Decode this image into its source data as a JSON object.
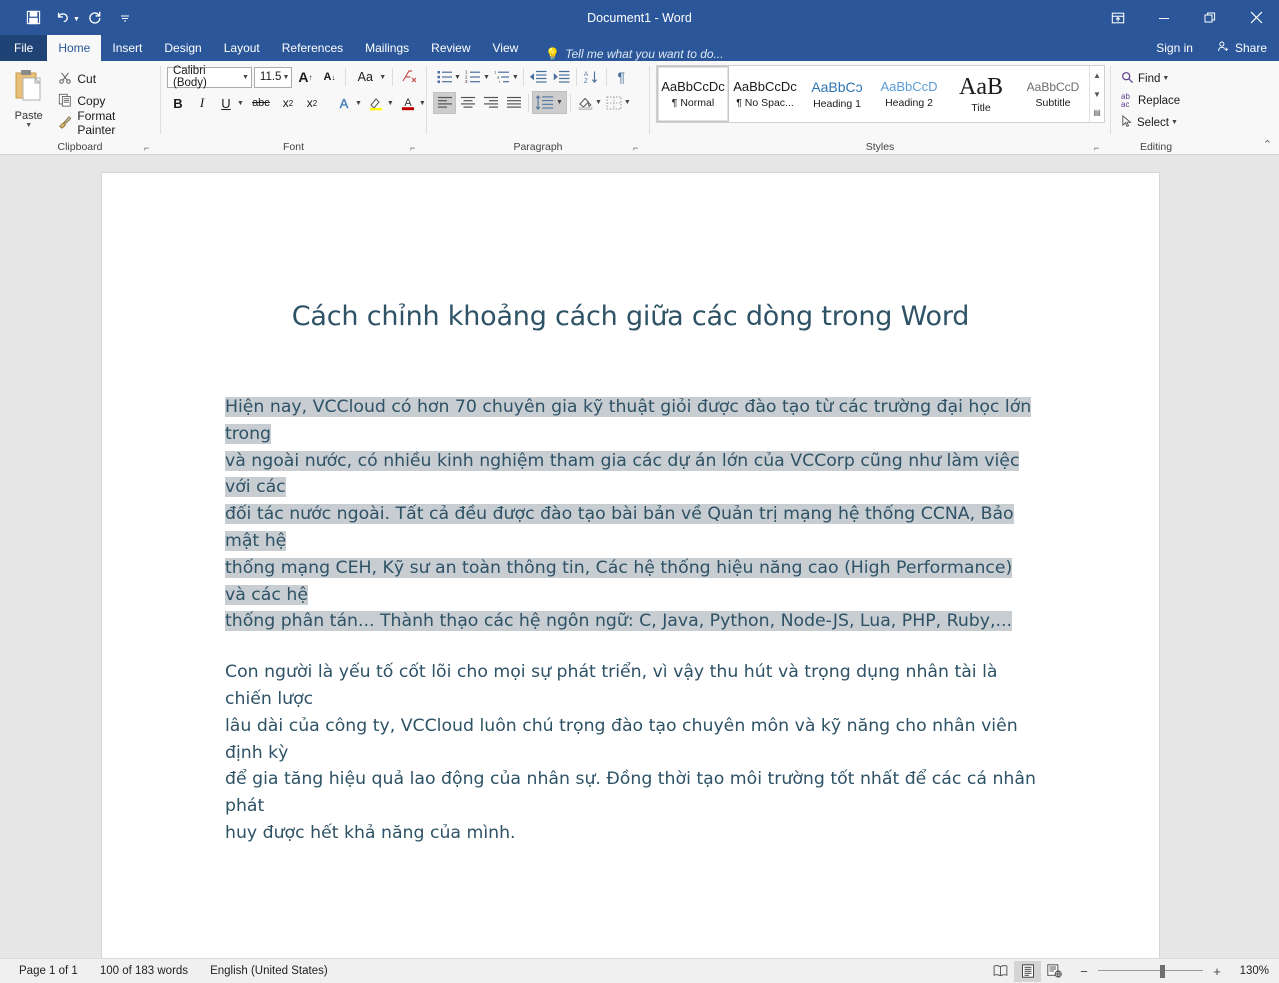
{
  "titlebar": {
    "document_title": "Document1 - Word",
    "quick_access": [
      {
        "name": "save-icon",
        "label": "Save"
      },
      {
        "name": "undo-icon",
        "label": "Undo"
      },
      {
        "name": "redo-icon",
        "label": "Redo"
      },
      {
        "name": "customize-qat-icon",
        "label": "Customize Quick Access Toolbar"
      }
    ],
    "window_controls": [
      {
        "name": "ribbon-display-options-icon",
        "label": "Ribbon Display Options"
      },
      {
        "name": "minimize-icon",
        "label": "Minimize"
      },
      {
        "name": "restore-icon",
        "label": "Restore Down"
      },
      {
        "name": "close-icon",
        "label": "Close"
      }
    ]
  },
  "tabs": {
    "items": [
      {
        "label": "File",
        "active": false
      },
      {
        "label": "Home",
        "active": true
      },
      {
        "label": "Insert",
        "active": false
      },
      {
        "label": "Design",
        "active": false
      },
      {
        "label": "Layout",
        "active": false
      },
      {
        "label": "References",
        "active": false
      },
      {
        "label": "Mailings",
        "active": false
      },
      {
        "label": "Review",
        "active": false
      },
      {
        "label": "View",
        "active": false
      }
    ],
    "tell_me": "Tell me what you want to do...",
    "sign_in": "Sign in",
    "share": "Share"
  },
  "ribbon": {
    "clipboard": {
      "label": "Clipboard",
      "paste": "Paste",
      "cut": "Cut",
      "copy": "Copy",
      "format_painter": "Format Painter"
    },
    "font": {
      "label": "Font",
      "font_name": "Calibri (Body)",
      "font_size": "11.5",
      "buttons": [
        {
          "name": "grow-font-icon",
          "label": "A"
        },
        {
          "name": "shrink-font-icon",
          "label": "A"
        },
        {
          "name": "change-case-icon",
          "label": "Aa"
        },
        {
          "name": "clear-formatting-icon",
          "label": "Clear All Formatting"
        },
        {
          "name": "bold-icon",
          "label": "B"
        },
        {
          "name": "italic-icon",
          "label": "I"
        },
        {
          "name": "underline-icon",
          "label": "U"
        },
        {
          "name": "strikethrough-icon",
          "label": "abc"
        },
        {
          "name": "subscript-icon",
          "label": "x₂"
        },
        {
          "name": "superscript-icon",
          "label": "x²"
        },
        {
          "name": "text-effects-icon",
          "label": "A"
        },
        {
          "name": "text-highlight-color-icon",
          "label": "ab"
        },
        {
          "name": "font-color-icon",
          "label": "A"
        }
      ]
    },
    "paragraph": {
      "label": "Paragraph",
      "buttons": [
        {
          "name": "bullets-icon",
          "label": "Bullets"
        },
        {
          "name": "numbering-icon",
          "label": "Numbering"
        },
        {
          "name": "multilevel-list-icon",
          "label": "Multilevel List"
        },
        {
          "name": "decrease-indent-icon",
          "label": "Decrease Indent"
        },
        {
          "name": "increase-indent-icon",
          "label": "Increase Indent"
        },
        {
          "name": "sort-icon",
          "label": "Sort"
        },
        {
          "name": "show-formatting-marks-icon",
          "label": "Show/Hide ¶"
        },
        {
          "name": "align-left-icon",
          "label": "Align Left"
        },
        {
          "name": "align-center-icon",
          "label": "Center"
        },
        {
          "name": "align-right-icon",
          "label": "Align Right"
        },
        {
          "name": "justify-icon",
          "label": "Justify"
        },
        {
          "name": "line-and-paragraph-spacing-icon",
          "label": "Line and Paragraph Spacing"
        },
        {
          "name": "shading-icon",
          "label": "Shading"
        },
        {
          "name": "borders-icon",
          "label": "Borders"
        }
      ],
      "highlighted_button": "line-and-paragraph-spacing-icon",
      "highlight_color": "#e81123"
    },
    "styles": {
      "label": "Styles",
      "items": [
        {
          "preview": "AaBbCcDc",
          "name": "¶ Normal",
          "selected": true,
          "kind": "normal"
        },
        {
          "preview": "AaBbCcDc",
          "name": "¶ No Spac...",
          "selected": false,
          "kind": "normal"
        },
        {
          "preview": "AaBbCɔ",
          "name": "Heading 1",
          "selected": false,
          "kind": "h1"
        },
        {
          "preview": "AaBbCcD",
          "name": "Heading 2",
          "selected": false,
          "kind": "h2"
        },
        {
          "preview": "AaB",
          "name": "Title",
          "selected": false,
          "kind": "title"
        },
        {
          "preview": "AaBbCcD",
          "name": "Subtitle",
          "selected": false,
          "kind": "sub"
        }
      ]
    },
    "editing": {
      "label": "Editing",
      "find": "Find",
      "replace": "Replace",
      "select": "Select"
    }
  },
  "document": {
    "title": "Cách chỉnh khoảng cách giữa các dòng trong Word",
    "paragraphs": [
      {
        "selected": true,
        "lines": [
          "Hiện nay, VCCloud có hơn 70 chuyên gia kỹ thuật giỏi được đào tạo từ các trường đại học lớn trong",
          "và ngoài nước, có nhiều kinh nghiệm tham gia các dự án lớn của VCCorp cũng như làm việc với các",
          "đối tác nước ngoài. Tất cả đều được đào tạo bài bản về Quản trị mạng hệ thống CCNA, Bảo mật hệ",
          "thống mạng CEH, Kỹ sư an toàn thông tin, Các hệ thống hiệu năng cao (High Performance) và các hệ",
          "thống phân tán... Thành thạo các hệ ngôn ngữ: C, Java, Python, Node-JS, Lua, PHP, Ruby,..."
        ]
      },
      {
        "selected": false,
        "lines": [
          "Con người là yếu tố cốt lõi cho mọi sự phát triển, vì vậy thu hút và trọng dụng nhân tài là chiến lược",
          "lâu dài của công ty, VCCloud luôn chú trọng đào tạo chuyên môn và kỹ năng cho nhân viên định kỳ",
          "để gia tăng hiệu quả lao động của nhân sự. Đồng thời tạo môi trường tốt nhất để các cá nhân phát",
          "huy được hết khả năng của mình."
        ]
      }
    ],
    "text_color": "#2e5266",
    "selection_color": "#c8cdd2"
  },
  "statusbar": {
    "page": "Page 1 of 1",
    "words": "100 of 183 words",
    "language": "English (United States)",
    "views": [
      {
        "name": "read-mode-icon",
        "label": "Read Mode",
        "active": false
      },
      {
        "name": "print-layout-icon",
        "label": "Print Layout",
        "active": true
      },
      {
        "name": "web-layout-icon",
        "label": "Web Layout",
        "active": false
      }
    ],
    "zoom_out": "−",
    "zoom_in": "+",
    "zoom_level": "130%"
  }
}
